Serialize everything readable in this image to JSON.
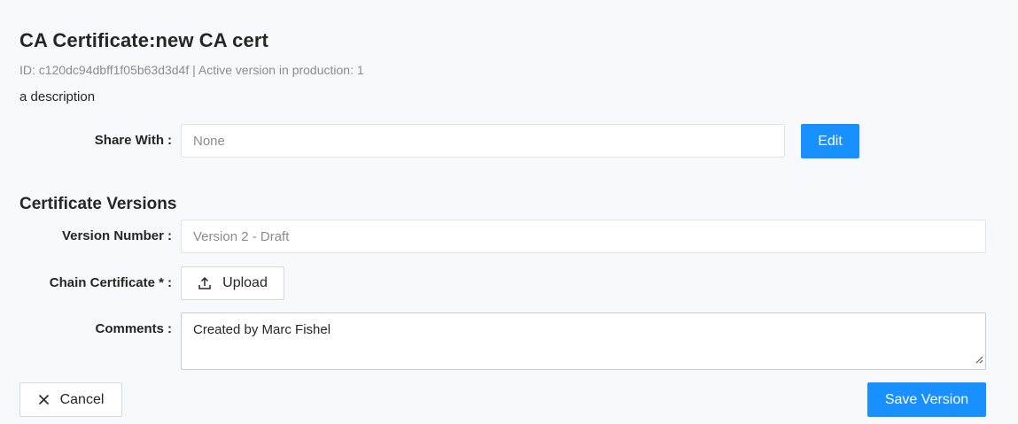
{
  "header": {
    "title": "CA Certificate:new CA cert",
    "meta": "ID: c120dc94dbff1f05b63d3d4f | Active version in production: 1",
    "description": "a description"
  },
  "share": {
    "label": "Share With",
    "value": "None",
    "edit_label": "Edit"
  },
  "versions": {
    "section_title": "Certificate Versions",
    "version_number_label": "Version Number",
    "version_number_value": "Version 2 - Draft",
    "chain_certificate_label": "Chain Certificate *",
    "upload_label": "Upload",
    "comments_label": "Comments",
    "comments_value": "Created by Marc Fishel"
  },
  "footer": {
    "cancel_label": "Cancel",
    "save_label": "Save Version"
  },
  "colors": {
    "primary": "#1890ff",
    "background": "#f8f9fd"
  }
}
